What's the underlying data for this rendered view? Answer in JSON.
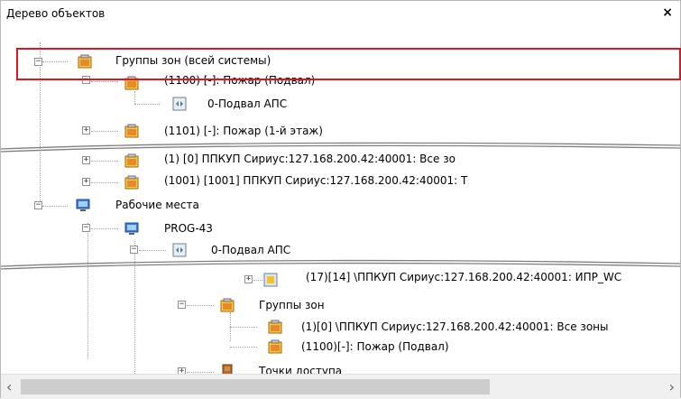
{
  "panel": {
    "title": "Дерево объектов",
    "close_glyph": "×"
  },
  "tree": {
    "zone_groups": "Группы зон (всей системы)",
    "zone_1100": "(1100) [-]: Пожар (Подвал)",
    "zone_1100_child": "0-Подвал АПС",
    "zone_1101": "(1101) [-]: Пожар (1-й этаж)",
    "ppkup_1": "(1) [0] ППКУП Сириус:127.168.200.42:40001: Все зо",
    "ppkup_1001": "(1001) [1001] ППКУП Сириус:127.168.200.42:40001: Т",
    "workplaces": "Рабочие места",
    "prog43": "PROG-43",
    "podval": "0-Подвал АПС",
    "item_17": "(17)[14] \\ППКУП Сириус:127.168.200.42:40001: ИПР_WC",
    "groups_zones": "Группы зон",
    "sub_1_0": "(1)[0] \\ППКУП Сириус:127.168.200.42:40001: Все зоны",
    "sub_1100": "(1100)[-]: Пожар (Подвал)",
    "access_points": "Точки доступа"
  },
  "scrollbar": {
    "left_arrow": "‹",
    "right_arrow": "›"
  },
  "colors": {
    "highlight": "#e0161f",
    "tree_line": "#a0a0a0",
    "break_line": "#808080"
  }
}
